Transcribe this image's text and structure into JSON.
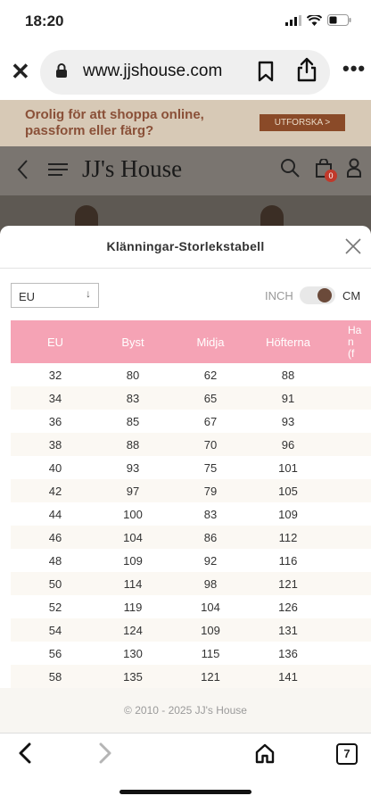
{
  "status_bar": {
    "time": "18:20"
  },
  "browser": {
    "url": "www.jjshouse.com",
    "tab_count": "7"
  },
  "page": {
    "banner_line1": "Orolig för att shoppa online,",
    "banner_line2": "passform eller färg?",
    "banner_button": "UTFORSKA >",
    "logo": "JJ's House",
    "cart_count": "0"
  },
  "modal": {
    "title": "Klänningar-Storlekstabell",
    "region_selected": "EU",
    "unit_inch": "INCH",
    "unit_cm": "CM",
    "selected_unit": "CM",
    "table": {
      "headers": [
        "EU",
        "Byst",
        "Midja",
        "Höfterna"
      ],
      "cut_header": "Ha\nn\n(f",
      "rows": [
        [
          "32",
          "80",
          "62",
          "88"
        ],
        [
          "34",
          "83",
          "65",
          "91"
        ],
        [
          "36",
          "85",
          "67",
          "93"
        ],
        [
          "38",
          "88",
          "70",
          "96"
        ],
        [
          "40",
          "93",
          "75",
          "101"
        ],
        [
          "42",
          "97",
          "79",
          "105"
        ],
        [
          "44",
          "100",
          "83",
          "109"
        ],
        [
          "46",
          "104",
          "86",
          "112"
        ],
        [
          "48",
          "109",
          "92",
          "116"
        ],
        [
          "50",
          "114",
          "98",
          "121"
        ],
        [
          "52",
          "119",
          "104",
          "126"
        ],
        [
          "54",
          "124",
          "109",
          "131"
        ],
        [
          "56",
          "130",
          "115",
          "136"
        ],
        [
          "58",
          "135",
          "121",
          "141"
        ]
      ]
    }
  },
  "footer": {
    "copyright": "© 2010 - 2025 JJ's House"
  },
  "colors": {
    "header_pink": "#f5a3b5",
    "toggle_knob": "#6b4a3a",
    "banner_button": "#8a4a28",
    "badge": "#c0392b"
  }
}
